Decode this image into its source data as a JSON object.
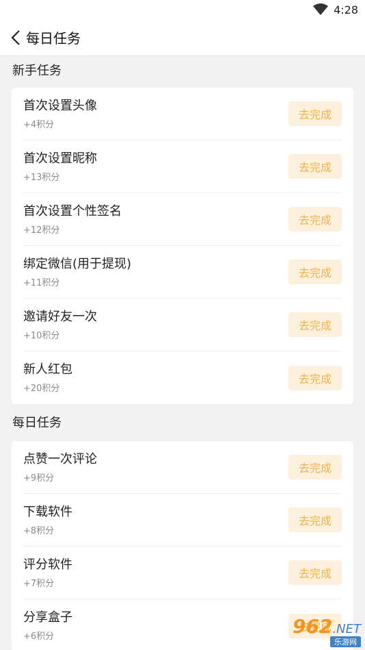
{
  "status_bar": {
    "time": "4:28",
    "wifi_icon": "wifi-icon"
  },
  "header": {
    "back_icon": "chevron-left-icon",
    "title": "每日任务"
  },
  "sections": [
    {
      "title": "新手任务",
      "tasks": [
        {
          "name": "首次设置头像",
          "points": "+4积分",
          "button": "去完成"
        },
        {
          "name": "首次设置昵称",
          "points": "+13积分",
          "button": "去完成"
        },
        {
          "name": "首次设置个性签名",
          "points": "+12积分",
          "button": "去完成"
        },
        {
          "name": "绑定微信(用于提现)",
          "points": "+11积分",
          "button": "去完成"
        },
        {
          "name": "邀请好友一次",
          "points": "+10积分",
          "button": "去完成"
        },
        {
          "name": "新人红包",
          "points": "+20积分",
          "button": "去完成"
        }
      ]
    },
    {
      "title": "每日任务",
      "tasks": [
        {
          "name": "点赞一次评论",
          "points": "+9积分",
          "button": "去完成"
        },
        {
          "name": "下载软件",
          "points": "+8积分",
          "button": "去完成"
        },
        {
          "name": "评分软件",
          "points": "+7积分",
          "button": "去完成"
        },
        {
          "name": "分享盒子",
          "points": "+6积分",
          "button": "去完成"
        }
      ]
    }
  ],
  "watermark": {
    "brand": "962",
    "suffix": ".NET",
    "subtitle": "乐游网"
  },
  "colors": {
    "button_bg": "#fdf0dc",
    "button_text": "#f0b24a",
    "page_bg": "#f2f2f2"
  }
}
